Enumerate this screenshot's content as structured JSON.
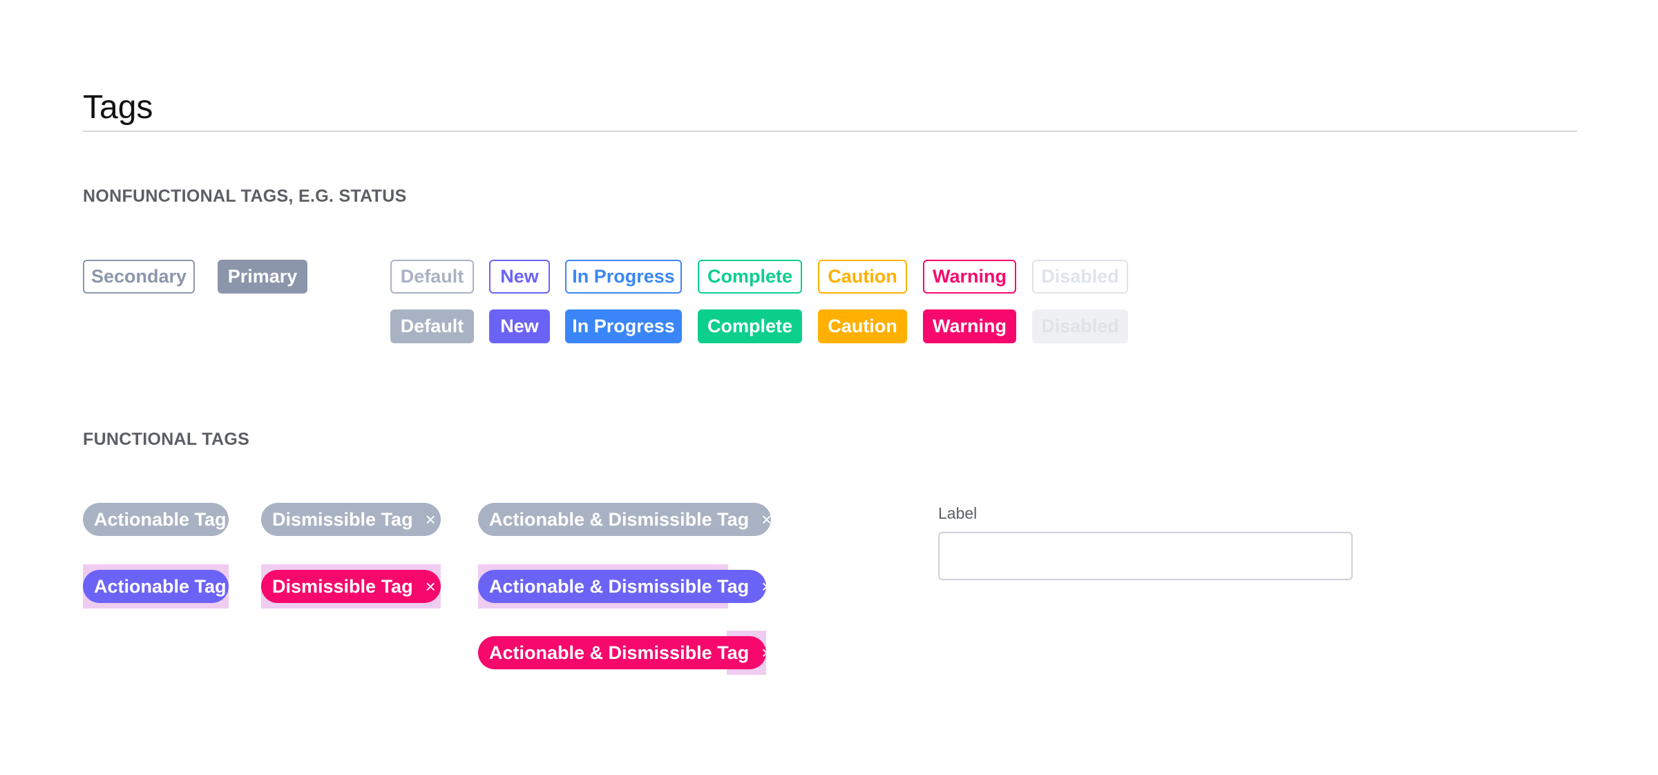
{
  "page": {
    "title": "Tags"
  },
  "nonfunctional": {
    "heading": "NONFUNCTIONAL TAGS, E.G. STATUS",
    "secondary_label": "Secondary",
    "primary_label": "Primary",
    "status_labels": [
      "Default",
      "New",
      "In Progress",
      "Complete",
      "Caution",
      "Warning",
      "Disabled"
    ],
    "status_colors": {
      "default": "#a9b2c3",
      "new": "#6b63f6",
      "in_progress": "#3a86f8",
      "complete": "#0ccf8c",
      "caution": "#ffb000",
      "warning": "#f7086d",
      "disabled": "#eef0f3"
    }
  },
  "functional": {
    "heading": "FUNCTIONAL TAGS",
    "actionable_label": "Actionable Tag",
    "dismissible_label": "Dismissible Tag",
    "actionable_dismissible_label": "Actionable & Dismissible Tag",
    "dismiss_glyph": "×",
    "colors": {
      "neutral": "#a9b2c3",
      "active": "#6b63f6",
      "danger": "#f7086d",
      "highlight": "#efcdf0"
    }
  },
  "field": {
    "label": "Label",
    "value": ""
  }
}
